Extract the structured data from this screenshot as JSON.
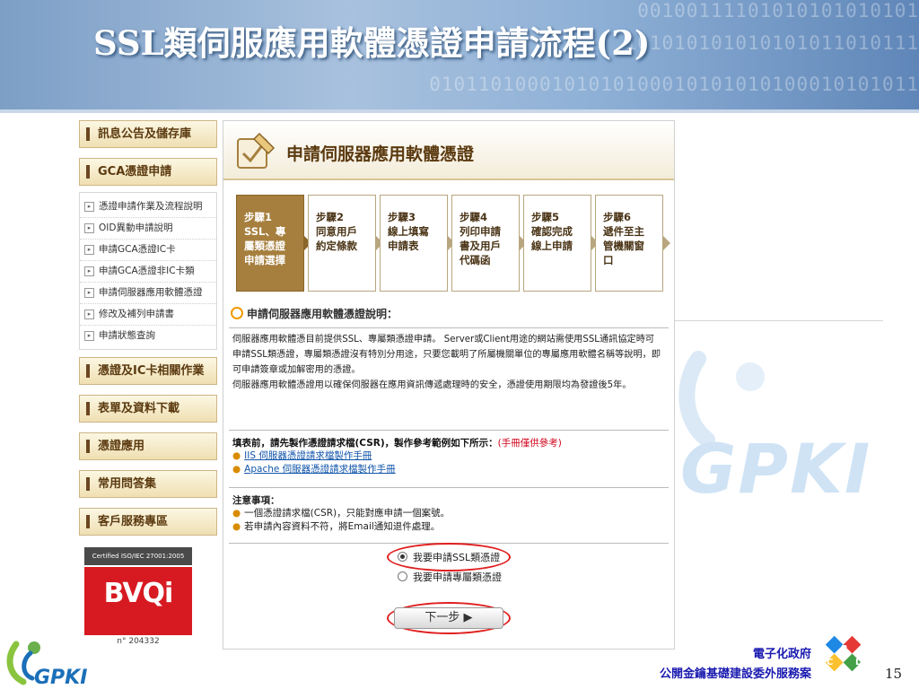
{
  "slide": {
    "title": "SSL類伺服應用軟體憑證申請流程(2)",
    "binary_lines": [
      "00100111101010101010101",
      "101010101010101011010111",
      "0101101000101010100010101010100010101011"
    ],
    "page_number": "15",
    "footer_line1": "電子化政府",
    "footer_line2": "公開金鑰基礎建設委外服務案",
    "bg_logo_text": "GPKI",
    "footer_logo_text": "GPKI",
    "rdec_letters": [
      "R",
      "D",
      "E",
      "C"
    ]
  },
  "nav": {
    "top_buttons": [
      "訊息公告及儲存庫",
      "GCA憑證申請"
    ],
    "sub_items": [
      "憑證申請作業及流程說明",
      "OID異動申請說明",
      "申請GCA憑證IC卡",
      "申請GCA憑證非IC卡類",
      "申請伺服器應用軟體憑證",
      "修改及補列申請書",
      "申請狀態查詢"
    ],
    "bottom_buttons": [
      "憑證及IC卡相關作業",
      "表單及資料下載",
      "憑證應用",
      "常用問答集",
      "客戶服務專區"
    ]
  },
  "cert": {
    "caption": "Certified ISO/IEC 27001:2005",
    "logo": "BVQi",
    "number": "n° 204332"
  },
  "content": {
    "header_title": "申請伺服器應用軟體憑證",
    "steps": [
      {
        "lines": [
          "步驟1",
          "SSL、專",
          "屬類憑證",
          "申請選擇"
        ],
        "active": true
      },
      {
        "lines": [
          "步驟2",
          "同意用戶",
          "約定條款"
        ],
        "active": false
      },
      {
        "lines": [
          "步驟3",
          "線上填寫",
          "申請表"
        ],
        "active": false
      },
      {
        "lines": [
          "步驟4",
          "列印申請",
          "書及用戶",
          "代碼函"
        ],
        "active": false
      },
      {
        "lines": [
          "步驟5",
          "確認完成",
          "線上申請"
        ],
        "active": false
      },
      {
        "lines": [
          "步驟6",
          "遞件至主",
          "管機關窗",
          "口"
        ],
        "active": false
      }
    ],
    "section_title": "申請伺服器應用軟體憑證說明：",
    "desc_p1": "伺服器應用軟體憑目前提供SSL、專屬類憑證申請。 Server或Client用途的網站需使用SSL通訊協定時可申請SSL類憑證，專屬類憑證沒有特別分用途，只要您載明了所屬機關單位的專屬應用軟體名稱等說明，即可申請簽章或加解密用的憑證。",
    "desc_p2": "伺服器應用軟體憑證用以確保伺服器在應用資訊傳遞處理時的安全，憑證使用期限均為發證後5年。",
    "csr_head": "填表前，請先製作憑證請求檔(CSR)，製作參考範例如下所示：",
    "csr_note": "(手冊僅供參考)",
    "csr_links": [
      "IIS 伺服器憑證請求檔製作手冊",
      "Apache 伺服器憑證請求檔製作手冊"
    ],
    "notes_head": "注意事項：",
    "notes": [
      "一個憑證請求檔(CSR)，只能對應申請一個案號。",
      "若申請內容資料不符，將Email通知退件處理。"
    ],
    "radio_options": [
      {
        "label": "我要申請SSL類憑證",
        "checked": true
      },
      {
        "label": "我要申請專屬類憑證",
        "checked": false
      }
    ],
    "next_label": "下一步 ▶"
  },
  "colors": {
    "banner": "#8eb0d6",
    "nav_text": "#5b3a10",
    "step_active": "#a67f3e",
    "highlight": "#e02020",
    "footer_text": "#1a1ab0"
  }
}
